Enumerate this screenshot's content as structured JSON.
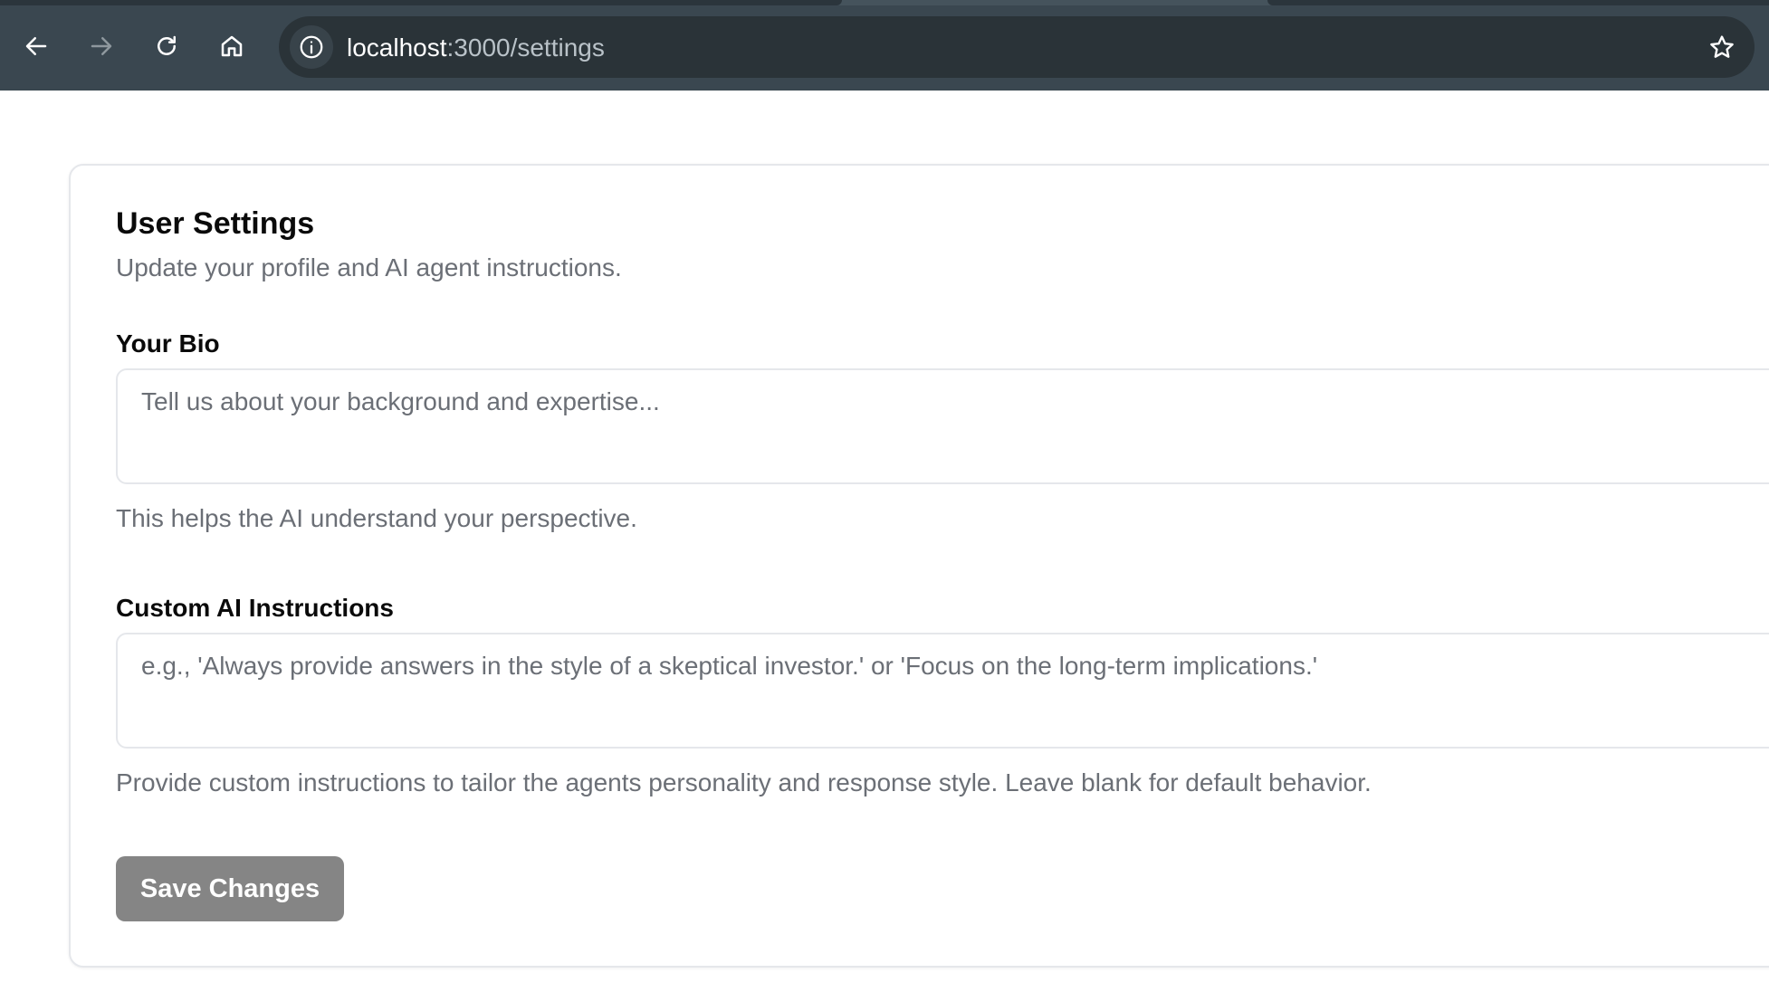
{
  "browser": {
    "url_host": "localhost",
    "url_path": ":3000/settings"
  },
  "icons": {
    "back": "back-arrow-icon",
    "forward": "forward-arrow-icon",
    "reload": "reload-icon",
    "home": "home-icon",
    "site_info": "info-icon",
    "bookmark": "star-icon"
  },
  "card": {
    "title": "User Settings",
    "subtitle": "Update your profile and AI agent instructions.",
    "bio": {
      "label": "Your Bio",
      "value": "",
      "placeholder": "Tell us about your background and expertise...",
      "help": "This helps the AI understand your perspective."
    },
    "instructions": {
      "label": "Custom AI Instructions",
      "value": "",
      "placeholder": "e.g., 'Always provide answers in the style of a skeptical investor.' or 'Focus on the long-term implications.'",
      "help": "Provide custom instructions to tailor the agents personality and response style. Leave blank for default behavior."
    },
    "save_label": "Save Changes"
  },
  "colors": {
    "chrome_bg": "#3a4750",
    "omnibox_bg": "#2a3338",
    "button_disabled": "#858585",
    "muted_text": "#6b6f76"
  }
}
